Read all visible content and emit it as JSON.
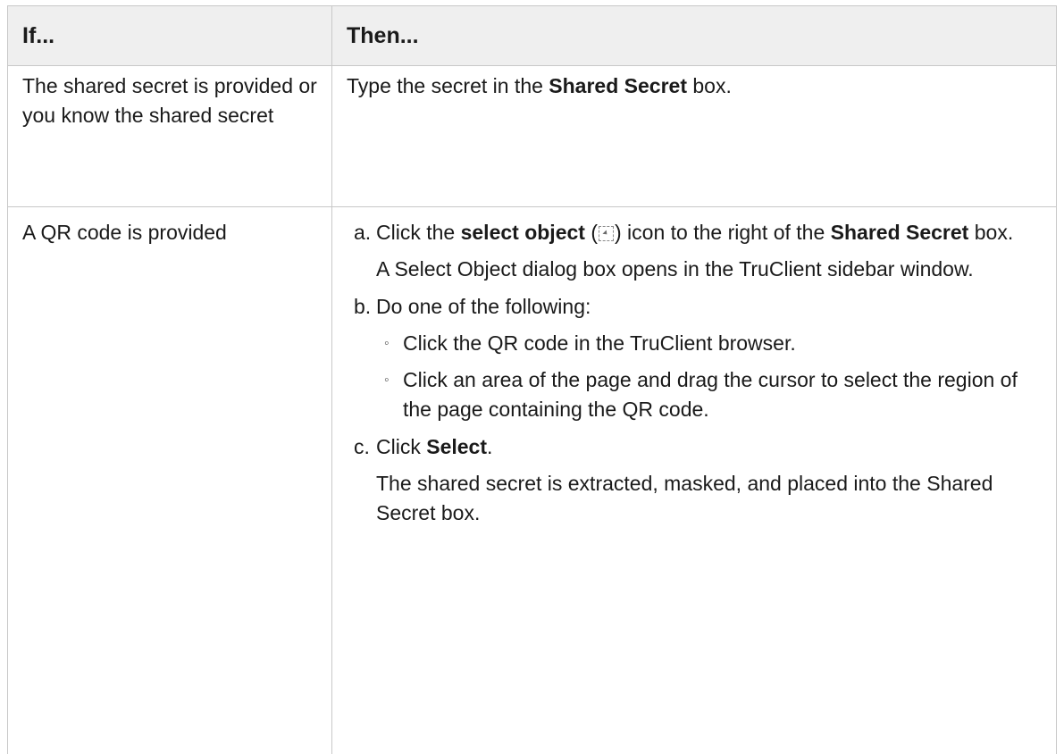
{
  "table": {
    "headers": [
      "If...",
      "Then..."
    ],
    "rows": [
      {
        "condition": "The shared secret is provided or you know the shared secret",
        "action": {
          "pre": "Type the secret in the ",
          "bold": "Shared Secret",
          "post": " box."
        }
      },
      {
        "condition": "A QR code is provided",
        "steps": [
          {
            "letter": "a.",
            "t1": "Click the ",
            "b1": "select object",
            "t2": " (",
            "icon": "select-object-icon",
            "t3": ") icon to the right of the ",
            "b2": "Shared Secret",
            "t4": " box.",
            "note": "A Select Object dialog box opens in the TruClient sidebar window."
          },
          {
            "letter": "b.",
            "text": "Do one of the following:",
            "bullet": "◦",
            "subitems": [
              "Click the QR code in the TruClient browser.",
              "Click an area of the page and drag the cursor to select the region of the page containing the QR code."
            ]
          },
          {
            "letter": "c.",
            "t1": "Click ",
            "b1": "Select",
            "t2": ".",
            "note": "The shared secret is extracted, masked, and placed into the Shared Secret box."
          }
        ]
      }
    ]
  }
}
